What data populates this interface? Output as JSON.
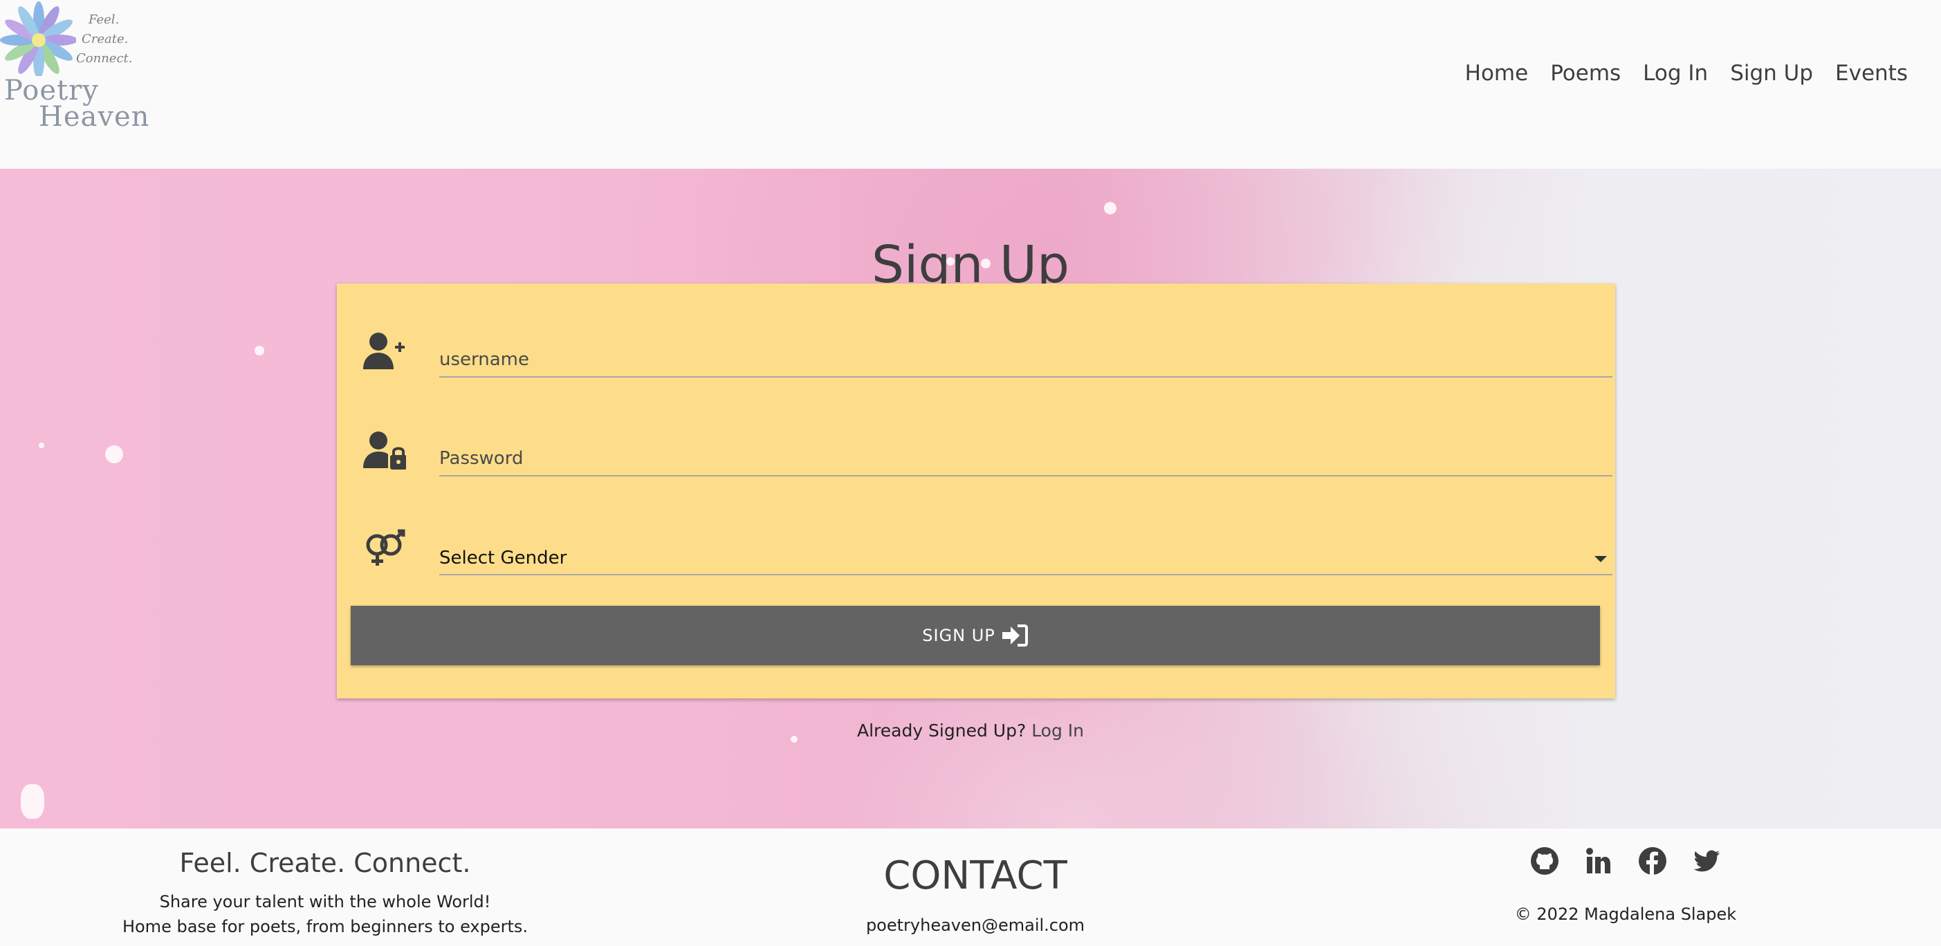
{
  "header": {
    "logo": {
      "tagline_1": "Feel.",
      "tagline_2": "Create.",
      "tagline_3": "Connect.",
      "name_1": "Poetry",
      "name_2": "Heaven"
    },
    "nav": [
      "Home",
      "Poems",
      "Log In",
      "Sign Up",
      "Events"
    ]
  },
  "main": {
    "title": "Sign Up",
    "form": {
      "username_placeholder": "username",
      "password_placeholder": "Password",
      "gender_selected": "Select Gender",
      "submit_label": "SIGN UP"
    },
    "already_text": "Already Signed Up?",
    "login_link": "Log In"
  },
  "footer": {
    "slogan": "Feel. Create. Connect.",
    "line_1": "Share your talent with the whole World!",
    "line_2": "Home base for poets, from beginners to experts.",
    "contact_heading": "CONTACT",
    "email": "poetryheaven@email.com",
    "social_icons": [
      "github-icon",
      "linkedin-icon",
      "facebook-icon",
      "twitter-icon"
    ],
    "copyright": "© 2022 Magdalena Slapek"
  },
  "colors": {
    "card": "#fedd8a",
    "button": "#636363",
    "text": "#3e3e3e",
    "hero_pink": "#f5bcd8"
  }
}
